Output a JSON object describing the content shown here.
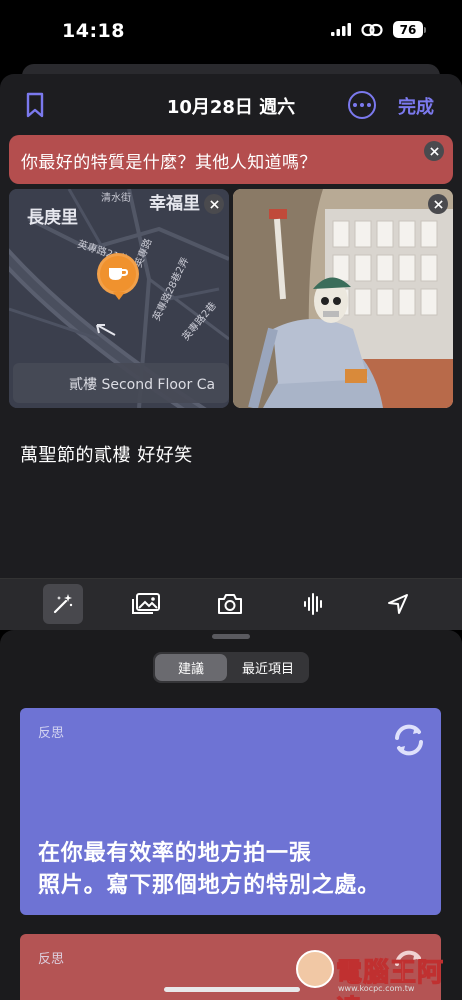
{
  "status": {
    "time": "14:18",
    "battery": "76"
  },
  "nav": {
    "title": "10月28日 週六",
    "done_label": "完成"
  },
  "prompt": {
    "text": "你最好的特質是什麼？其他人知道嗎？"
  },
  "map": {
    "place_labels": [
      "長庚里",
      "幸福里"
    ],
    "street_labels": [
      "清水街",
      "英專路21巷",
      "英專路",
      "英專路28巷2弄",
      "英專路2巷"
    ],
    "caption": "貳樓 Second Floor Ca"
  },
  "note": {
    "text": "萬聖節的貳樓 好好笑"
  },
  "toolbar": {
    "icons": [
      "magic-wand-icon",
      "photo-library-icon",
      "camera-icon",
      "audio-waveform-icon",
      "location-arrow-icon"
    ]
  },
  "suggestions": {
    "tabs": [
      "建議",
      "最近項目"
    ],
    "cards": [
      {
        "tag": "反思",
        "line1": "在你最有效率的地方拍一張",
        "line2": "照片。寫下那個地方的特別之處。",
        "color": "#6e73d4"
      },
      {
        "tag": "反思",
        "color": "#b45454"
      }
    ]
  },
  "watermark": {
    "text": "電腦王阿達",
    "url": "www.kocpc.com.tw"
  },
  "colors": {
    "accent": "#7b79ee",
    "banner": "#b44e4e",
    "card_blue": "#6e73d4",
    "card_red": "#b45454"
  }
}
